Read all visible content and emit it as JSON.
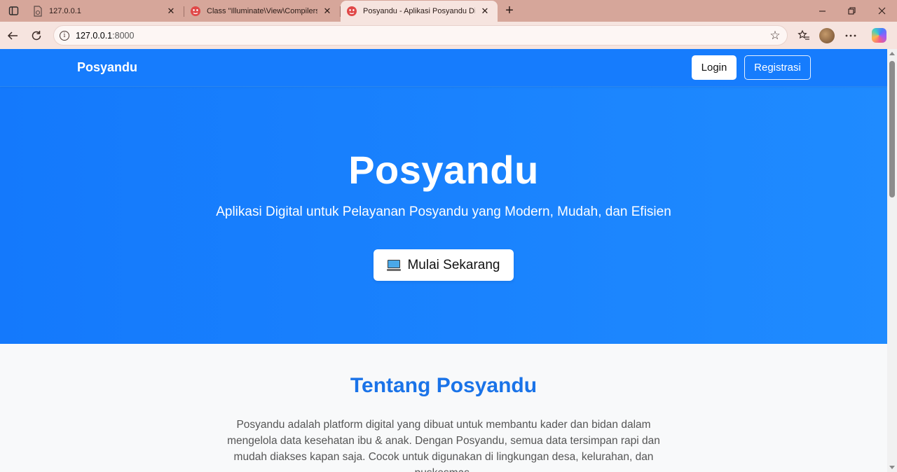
{
  "browser": {
    "tabs": [
      {
        "title": "127.0.0.1",
        "favicon": "document-icon"
      },
      {
        "title": "Class \"Illuminate\\View\\Compilers\\",
        "favicon": "laravel-icon"
      },
      {
        "title": "Posyandu - Aplikasi Posyandu Dig",
        "favicon": "laravel-icon"
      }
    ],
    "address_host": "127.0.0.1",
    "address_port": ":8000"
  },
  "navbar": {
    "brand": "Posyandu",
    "login_label": "Login",
    "register_label": "Registrasi"
  },
  "hero": {
    "title": "Posyandu",
    "subtitle": "Aplikasi Digital untuk Pelayanan Posyandu yang Modern, Mudah, dan Efisien",
    "cta_label": "Mulai Sekarang",
    "cta_icon": "computer-icon"
  },
  "about": {
    "title": "Tentang Posyandu",
    "text": "Posyandu adalah platform digital yang dibuat untuk membantu kader dan bidan dalam mengelola data kesehatan ibu & anak. Dengan Posyandu, semua data tersimpan rapi dan mudah diakses kapan saja. Cocok untuk digunakan di lingkungan desa, kelurahan, dan puskesmas."
  },
  "colors": {
    "hero_blue": "#1479fc",
    "about_title_blue": "#1a73e8",
    "tabstrip": "#d6a69a",
    "toolbar": "#f6e4df"
  }
}
